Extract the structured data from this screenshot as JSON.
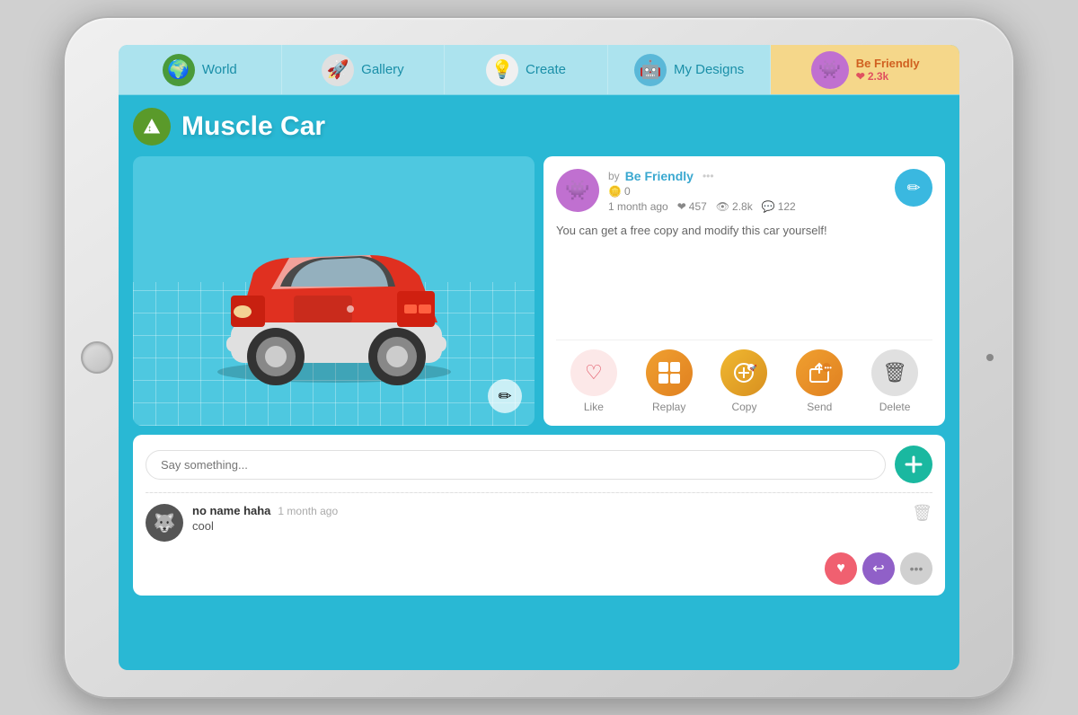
{
  "nav": {
    "items": [
      {
        "id": "world",
        "label": "World",
        "icon": "🌍"
      },
      {
        "id": "gallery",
        "label": "Gallery",
        "icon": "🚀"
      },
      {
        "id": "create",
        "label": "Create",
        "icon": "💡"
      },
      {
        "id": "mydesigns",
        "label": "My Designs",
        "icon": "🤖"
      },
      {
        "id": "beFriendly",
        "label": "Be Friendly",
        "likes": "❤ 2.3k",
        "icon": "👾"
      }
    ]
  },
  "page": {
    "title": "Muscle Car",
    "header_icon": "⬆️"
  },
  "author": {
    "name": "Be Friendly",
    "by_label": "by",
    "coins": "0",
    "time_ago": "1 month ago",
    "likes": "457",
    "views": "2.8k",
    "comments_count": "122",
    "description": "You can get a free copy and modify this car yourself!"
  },
  "actions": [
    {
      "id": "like",
      "label": "Like",
      "icon": "♡"
    },
    {
      "id": "replay",
      "label": "Replay",
      "icon": "⊞"
    },
    {
      "id": "copy",
      "label": "Copy",
      "icon": "✦"
    },
    {
      "id": "send",
      "label": "Send",
      "icon": "⬆"
    },
    {
      "id": "delete",
      "label": "Delete",
      "icon": "🗑"
    }
  ],
  "comments": {
    "placeholder": "Say something...",
    "submit_icon": "✚",
    "items": [
      {
        "author": "no name haha",
        "time": "1 month ago",
        "text": "cool",
        "avatar_emoji": "🐺"
      }
    ]
  },
  "icons": {
    "pencil": "✏",
    "edit": "✏",
    "dots": "•••",
    "heart": "♥",
    "eye": "👁",
    "comment": "💬",
    "coin": "🪙",
    "trash": "🗑",
    "reply": "↩",
    "more": "•••"
  }
}
